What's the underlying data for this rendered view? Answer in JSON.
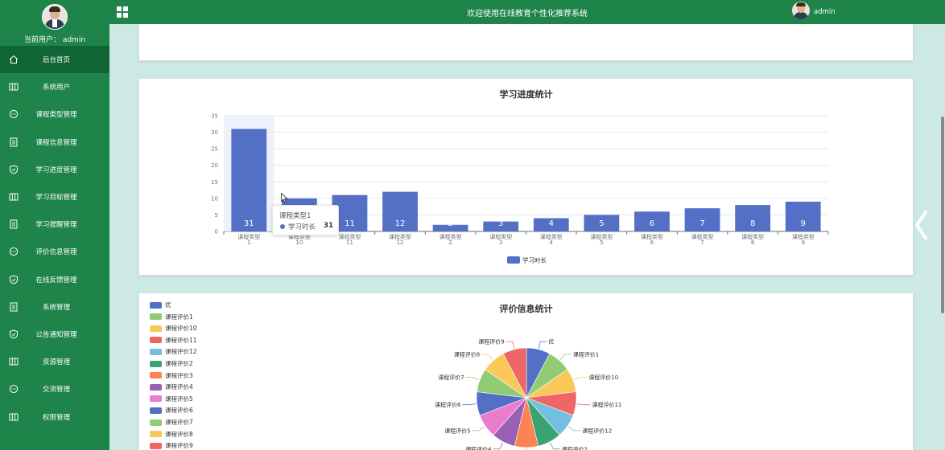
{
  "sidebar": {
    "user_label": "当前用户： admin",
    "items": [
      {
        "label": "后台首页",
        "icon": "home-icon",
        "active": true
      },
      {
        "label": "系统用户",
        "icon": "columns-icon"
      },
      {
        "label": "课程类型管理",
        "icon": "chat-icon"
      },
      {
        "label": "课程信息管理",
        "icon": "document-icon"
      },
      {
        "label": "学习进度管理",
        "icon": "shield-icon"
      },
      {
        "label": "学习目标管理",
        "icon": "columns-icon"
      },
      {
        "label": "学习提醒管理",
        "icon": "document-icon"
      },
      {
        "label": "评价信息管理",
        "icon": "chat-icon"
      },
      {
        "label": "在线反馈管理",
        "icon": "shield-icon"
      },
      {
        "label": "系统管理",
        "icon": "document-icon"
      },
      {
        "label": "公告通知管理",
        "icon": "shield-icon"
      },
      {
        "label": "资源管理",
        "icon": "columns-icon"
      },
      {
        "label": "交流管理",
        "icon": "chat-icon"
      },
      {
        "label": "权限管理",
        "icon": "columns-icon"
      }
    ]
  },
  "header": {
    "title": "欢迎使用在线教育个性化推荐系统",
    "username": "admin"
  },
  "colors": {
    "brand": "#1e8449",
    "brand_dark": "#0f6634",
    "background": "#cde9e4",
    "bar": "#5470c6"
  },
  "chart_data": [
    {
      "type": "bar",
      "title": "学习进度统计",
      "categories": [
        "课程类型\n1",
        "课程类型\n10",
        "课程类型\n11",
        "课程类型\n12",
        "课程类型\n2",
        "课程类型\n3",
        "课程类型\n4",
        "课程类型\n5",
        "课程类型\n6",
        "课程类型\n7",
        "课程类型\n8",
        "课程类型\n9"
      ],
      "series": [
        {
          "name": "学习时长",
          "values": [
            31,
            10,
            11,
            12,
            2,
            3,
            4,
            5,
            6,
            7,
            8,
            9
          ]
        }
      ],
      "ylim": [
        0,
        35
      ],
      "yticks": [
        0,
        5,
        10,
        15,
        20,
        25,
        30,
        35
      ],
      "grid": true,
      "legend": "bottom",
      "highlighted_category_index": 0,
      "tooltip": {
        "title": "课程类型1",
        "series": "学习时长",
        "value": 31
      }
    },
    {
      "type": "pie",
      "title": "评价信息统计",
      "legend": "left",
      "labels": [
        "优",
        "课程评价1",
        "课程评价10",
        "课程评价11",
        "课程评价12",
        "课程评价2",
        "课程评价3",
        "课程评价4",
        "课程评价5",
        "课程评价6",
        "课程评价7",
        "课程评价8",
        "课程评价9"
      ],
      "values": [
        1,
        1,
        1,
        1,
        1,
        1,
        1,
        1,
        1,
        1,
        1,
        1,
        1
      ],
      "colors": [
        "#5470c6",
        "#91cc75",
        "#fac858",
        "#ee6666",
        "#73c0de",
        "#3ba272",
        "#fc8452",
        "#9a60b4",
        "#ea7ccc",
        "#5470c6",
        "#91cc75",
        "#fac858",
        "#ee6666"
      ]
    }
  ]
}
